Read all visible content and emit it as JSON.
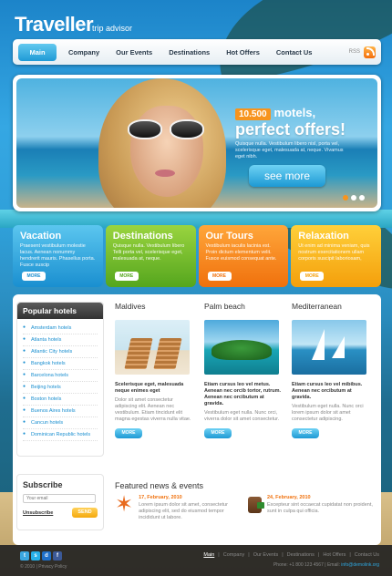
{
  "header": {
    "logo": "Traveller",
    "tagline": "trip advisor"
  },
  "nav": {
    "items": [
      "Main",
      "Company",
      "Our Events",
      "Destinations",
      "Hot Offers",
      "Contact Us"
    ],
    "rss_label": "RSS"
  },
  "hero": {
    "badge": "10.500",
    "badge_suffix": "motels,",
    "headline": "perfect offers!",
    "description": "Quisque nulla. Vestibulum libero nisl, porta vel, scelerisque eget, malesuada at, neque. Vivamus eget nibh.",
    "button": "see more"
  },
  "tiles": [
    {
      "title": "Vacation",
      "text": "Praesent vestibulum molestie lacus. Aenean nonummy hendrerit mauris. Phasellus porta. Fusce suscip",
      "more": "MORE"
    },
    {
      "title": "Destinations",
      "text": "Quisque nulla. Vestibulum libero Telli porta vel, scelerisque eget, malesuada at, neque.",
      "more": "MORE"
    },
    {
      "title": "Our Tours",
      "text": "Vestibulum iaculis lacinia est. Proin dictum elementum velit. Fusce euismod consequat ante.",
      "more": "MORE"
    },
    {
      "title": "Relaxation",
      "text": "Ut enim ad minima veniam, quis nostrum exercitationem ullam corporis suscipit laboriosam,",
      "more": "MORE"
    }
  ],
  "sidebar": {
    "title": "Popular hotels",
    "hotels": [
      "Amsterdam hotels",
      "Atlanta hotels",
      "Atlantic City hotels",
      "Bangkok hotels",
      "Barcelona hotels",
      "Beijing hotels",
      "Boston hotels",
      "Buenos Aires hotels",
      "Cancun hotels",
      "Dominican Republic hotels"
    ]
  },
  "subscribe": {
    "title": "Subscribe",
    "placeholder": "Your email",
    "unsubscribe": "Unsubscribe",
    "button": "SEND"
  },
  "destinations": [
    {
      "title": "Maldives",
      "bold": "Scelerisque eget, malesuada neque enimes eget",
      "text": "Dolor sit amet consectetur adipiscing elit. Aenean nec vestibulum. Etiam tincidunt elit magna egestas viverra nulla vitae.",
      "more": "MORE"
    },
    {
      "title": "Palm beach",
      "bold": "Etiam cursus leo vel metus. Aenean nec orcib tortor, rutrum. Aenean nec orcibutum at gravida.",
      "text": "Vestibulum eget nulla. Nunc orci, viverra dolor sit amet consectetur.",
      "more": "MORE"
    },
    {
      "title": "Mediterranean",
      "bold": "Etiam cursus leo vel mibibus. Aenean nec orcibutum at gravida.",
      "text": "Vestibulum eget nulla. Nunc orci lorem ipsum dolor sit amet consectetur adipiscing.",
      "more": "MORE"
    }
  ],
  "news": {
    "title": "Featured news & events",
    "items": [
      {
        "date_day": "17, February, 2010",
        "text": "Lorem ipsum dolor sit amet, consectetur adipiscing elit, sed do eiusmod tempor incididunt ut labore."
      },
      {
        "date_day": "24, February, 2010",
        "text": "Excepteur sint occaecat cupidatat non proident, sunt in culpa qui officia."
      }
    ]
  },
  "footer": {
    "copyright": "© 2010 | Privacy Policy",
    "links": [
      "Main",
      "Company",
      "Our Events",
      "Destinations",
      "Hot Offers",
      "Contact Us"
    ],
    "contact": "Phone: +1 800 123 4567  |  Email:",
    "email": "info@demolink.org",
    "social": [
      "t",
      "s",
      "d",
      "f"
    ]
  },
  "colors": {
    "accent": "#1d99d4",
    "orange": "#f7941d",
    "green": "#55a61e"
  }
}
